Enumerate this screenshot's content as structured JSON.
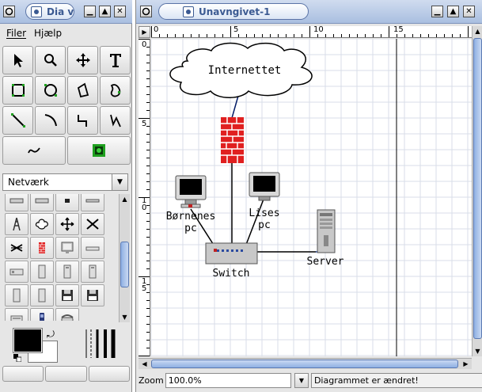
{
  "toolbox": {
    "title": "Dia v",
    "menu": [
      "Filer",
      "Hjælp"
    ],
    "sheet_selected": "Netværk"
  },
  "diagram_window": {
    "title": "Unavngivet-1"
  },
  "ruler": {
    "h_labels": [
      "0",
      "5",
      "10",
      "15"
    ],
    "v_labels": [
      "0",
      "5",
      "1\n0",
      "1\n5"
    ]
  },
  "diagram": {
    "cloud_label": "Internettet",
    "pc1_label": [
      "Børnenes",
      "pc"
    ],
    "pc2_label": [
      "Lises",
      "pc"
    ],
    "switch_label": "Switch",
    "server_label": "Server"
  },
  "status": {
    "zoom_label": "Zoom",
    "zoom_value": "100.0%",
    "message": "Diagrammet er ændret!"
  },
  "colors": {
    "title_text": "#3b5a92",
    "firewall": "#e02020",
    "grid": "#d8dde8",
    "scroll_thumb": "#8fb0e3"
  }
}
